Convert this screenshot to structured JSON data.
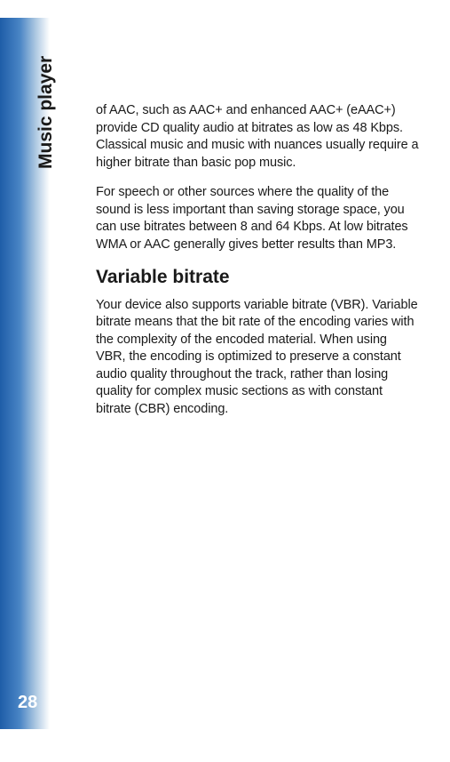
{
  "sidebar": {
    "section_title": "Music player",
    "page_number": "28"
  },
  "content": {
    "paragraph1": "of AAC, such as AAC+ and enhanced AAC+ (eAAC+) provide CD quality audio at bitrates as low as 48 Kbps. Classical music and music with nuances usually require a higher bitrate than basic pop music.",
    "paragraph2": "For speech or other sources where the quality of the sound is less important than saving storage space, you can use bitrates between 8 and 64 Kbps. At low bitrates WMA or AAC generally gives better results than MP3.",
    "heading1": "Variable bitrate",
    "paragraph3": "Your device also supports variable bitrate (VBR). Variable bitrate means that the bit rate of the encoding varies with the complexity of the encoded material. When using VBR, the encoding is optimized to preserve a constant audio quality throughout the track, rather than losing quality for complex music sections as with constant bitrate (CBR) encoding."
  }
}
